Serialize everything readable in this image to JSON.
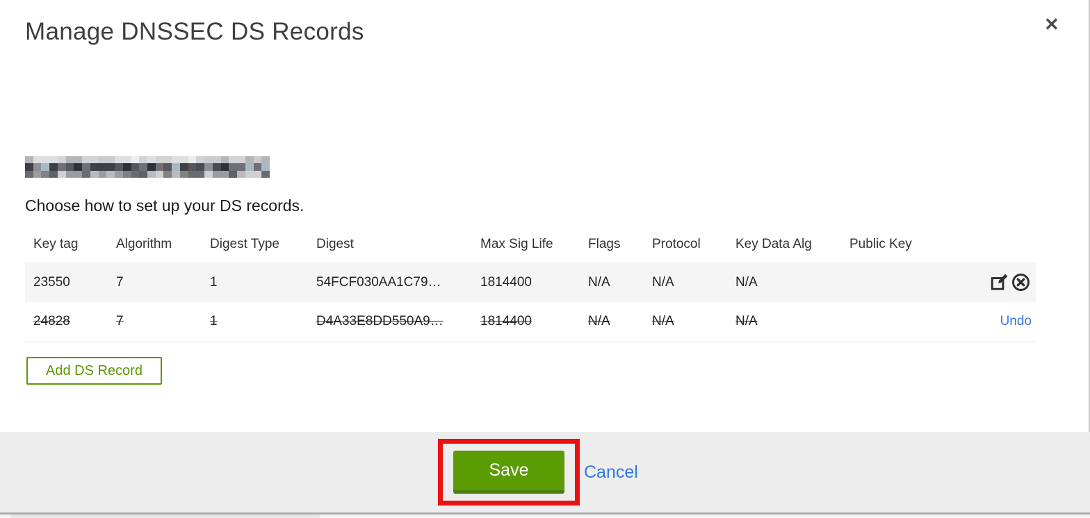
{
  "modal": {
    "title": "Manage DNSSEC DS Records",
    "instruction": "Choose how to set up your DS records.",
    "domain_redacted": true
  },
  "icons": {
    "close": "✕",
    "edit": "edit-record-icon",
    "delete": "delete-record-icon"
  },
  "table": {
    "columns": [
      "Key tag",
      "Algorithm",
      "Digest Type",
      "Digest",
      "Max Sig Life",
      "Flags",
      "Protocol",
      "Key Data Alg",
      "Public Key"
    ],
    "rows": [
      {
        "key_tag": "23550",
        "algorithm": "7",
        "digest_type": "1",
        "digest": "54FCF030AA1C79…",
        "max_sig_life": "1814400",
        "flags": "N/A",
        "protocol": "N/A",
        "key_data_alg": "N/A",
        "public_key": "",
        "state": "active"
      },
      {
        "key_tag": "24828",
        "algorithm": "7",
        "digest_type": "1",
        "digest": "D4A33E8DD550A9…",
        "max_sig_life": "1814400",
        "flags": "N/A",
        "protocol": "N/A",
        "key_data_alg": "N/A",
        "public_key": "",
        "state": "marked-for-deletion",
        "undo_label": "Undo"
      }
    ]
  },
  "actions": {
    "add_ds_record": "Add DS Record",
    "save": "Save",
    "cancel": "Cancel"
  },
  "colors": {
    "primary_green": "#5b9c05",
    "green_border_dark": "#4d7f10",
    "outline_green": "#5c9604",
    "link_blue": "#3179e0",
    "annotation_red": "#ec1111",
    "row_stripe": "#f5f5f5",
    "footer_bg": "#ededed"
  }
}
